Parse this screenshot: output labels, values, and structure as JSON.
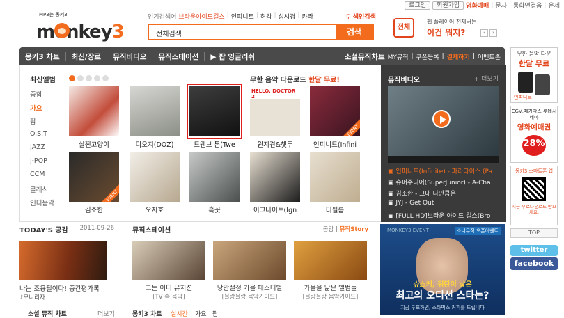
{
  "util": {
    "login": "로그인",
    "join": "회원가입",
    "mobile": "영화예매",
    "sms": "문자",
    "phone": "통화연결음",
    "fortune": "운세"
  },
  "logo": {
    "tagline": "MP3는 몽키3",
    "word": "monkey",
    "num": "3"
  },
  "trending": {
    "label": "인기검색어",
    "items": [
      "브라운아이드걸스",
      "인피니트",
      "허각",
      "성시경",
      "카라"
    ],
    "color_search": "색인검색"
  },
  "search": {
    "scope": "전체검색",
    "button": "검색"
  },
  "promo": {
    "box": "전체",
    "line1": "펩 플레이어 전체버튼",
    "line2": "이건 뭐지?"
  },
  "gnb": {
    "items": [
      "몽키3 차트",
      "최신/장르",
      "뮤직비디오",
      "뮤직스테이션",
      "팝 잉글리쉬"
    ],
    "right": [
      "소셜뮤직차트",
      "MY뮤직",
      "쿠폰등록",
      "결제하기",
      "이벤트존"
    ]
  },
  "albums": {
    "header": "최신앨범",
    "categories": [
      "종합",
      "가요",
      "팝",
      "O.S.T",
      "JAZZ",
      "J-POP",
      "CCM",
      "클래식",
      "인디음악"
    ],
    "free_dl": {
      "pre": "무한 음악 다운로드",
      "hi": "한달 무료!"
    },
    "items": [
      {
        "name": "살찐고양이"
      },
      {
        "name": "디오지(DOZ)"
      },
      {
        "name": "트웬브 톤(Twe"
      },
      {
        "name": "원지견&챗두"
      },
      {
        "name": "인피니트(Infini"
      },
      {
        "name": "김조한"
      },
      {
        "name": "오지호"
      },
      {
        "name": "흑꼿"
      },
      {
        "name": "이그나이트(Ign"
      },
      {
        "name": "더필름"
      }
    ],
    "event": "EVENT"
  },
  "mv": {
    "header": "뮤직비디오",
    "more": "+ 더보기",
    "items": [
      "인피니트(Infinite) - 파라다이스 (Pa",
      "슈퍼주니어(SuperJunior) - A-Cha",
      "김조한 - 그대 나만큼은",
      "JYJ - Get Out",
      "[FULL HD]브라운 아이드 걸스(Bro"
    ]
  },
  "ads": {
    "ad1": {
      "t1": "무한 음악 다운",
      "t2": "한달 무료",
      "logo": "인피니트"
    },
    "ad2": {
      "t1": "CGV,메가박스 롯데시네마",
      "t2": "영화예매권",
      "badge": "28%",
      "badge_sub": "할인"
    },
    "ad3": {
      "t1": "몽키3 스마트폰 앱",
      "t2": "지금 무료다운로드 받으세요."
    },
    "top": "TOP",
    "twitter": "twitter",
    "facebook": "facebook"
  },
  "today": {
    "header": "TODAY'S 공감",
    "date": "2011-09-26",
    "caption": "나는 조용필이다! 중간평가록",
    "sub": "♪모니리자"
  },
  "ms": {
    "header": "뮤직스테이션",
    "tab1": "공감",
    "tab2": "뮤직Story",
    "items": [
      {
        "title": "그는 이미 뮤지션",
        "sub": "[TV 속 음악]"
      },
      {
        "title": "낭만절정 가을 페스티벌",
        "sub": "[블랑블랑 음악가이드]"
      },
      {
        "title": "가을을 닮은 앨범들",
        "sub": "[블랑블랑 음악가이드]"
      }
    ]
  },
  "banner": {
    "tag": "MONKEY3 EVENT",
    "tag2": "소니뮤직 오픈이벤트",
    "l1": "슈스케, 위탄이 낳은",
    "l2": "최고의 오디션 스타는?",
    "l3": "지금 투표하면, 스타벅스 커피를 드립니다"
  },
  "bottom": {
    "a": "소셜 뮤직 차트",
    "b": "더보기",
    "c": "몽키3 차트",
    "d": "실시간",
    "e": "가요",
    "f": "팝"
  }
}
